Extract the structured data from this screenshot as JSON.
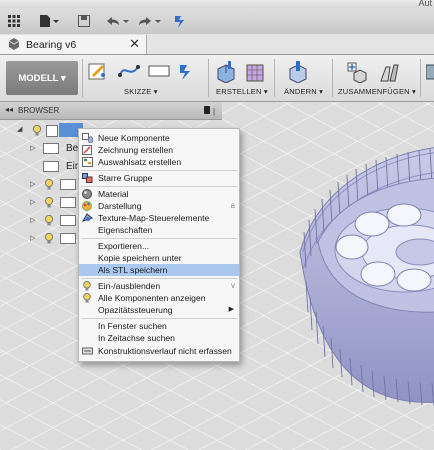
{
  "window": {
    "title_fragment": "Aut"
  },
  "quick_access": {
    "grid_icon": "apps-grid-icon",
    "file_icon": "file-icon",
    "save_icon": "save-icon",
    "undo_icon": "undo-icon",
    "redo_icon": "redo-icon",
    "logo_icon": "fusion-logo-icon"
  },
  "document_tab": {
    "label": "Bearing v6",
    "close": "✕"
  },
  "ribbon": {
    "workspace": "MODELL ▾",
    "groups": {
      "sketch": "SKIZZE ▾",
      "create": "ERSTELLEN ▾",
      "modify": "ÄNDERN ▾",
      "assemble": "ZUSAMMENFÜGEN ▾"
    }
  },
  "browser": {
    "title": "BROWSER",
    "rows": [
      {
        "label": ""
      },
      {
        "label": "Ber"
      },
      {
        "label": "Ein"
      },
      {
        "label": ""
      },
      {
        "label": ""
      },
      {
        "label": ""
      },
      {
        "label": ""
      }
    ]
  },
  "context_menu": {
    "items": [
      {
        "label": "Neue Komponente",
        "icon": "new-component-icon"
      },
      {
        "label": "Zeichnung erstellen",
        "icon": "drawing-icon"
      },
      {
        "label": "Auswahlsatz erstellen",
        "icon": "selection-set-icon"
      },
      {
        "label": "Starre Gruppe",
        "icon": "rigid-group-icon"
      },
      {
        "label": "Material",
        "icon": "material-icon"
      },
      {
        "label": "Darstellung",
        "icon": "appearance-icon",
        "shortcut": "a"
      },
      {
        "label": "Texture-Map-Steuerelemente",
        "icon": "texture-map-icon"
      },
      {
        "label": "Eigenschaften"
      },
      {
        "label": "Exportieren..."
      },
      {
        "label": "Kopie speichern unter"
      },
      {
        "label": "Als STL speichern",
        "highlighted": true
      },
      {
        "label": "Ein-/ausblenden",
        "icon": "bulb-icon",
        "shortcut": "v"
      },
      {
        "label": "Alle Komponenten anzeigen",
        "icon": "bulb-icon"
      },
      {
        "label": "Opazitätssteuerung",
        "submenu": "▶"
      },
      {
        "label": "In Fenster suchen"
      },
      {
        "label": "In Zeitachse suchen"
      },
      {
        "label": "Konstruktionsverlauf nicht erfassen",
        "icon": "history-icon"
      }
    ]
  },
  "colors": {
    "menu_highlight": "#aac8ee",
    "model_body": "#a8acd4",
    "ribbon_accent": "#2f6fc9"
  }
}
